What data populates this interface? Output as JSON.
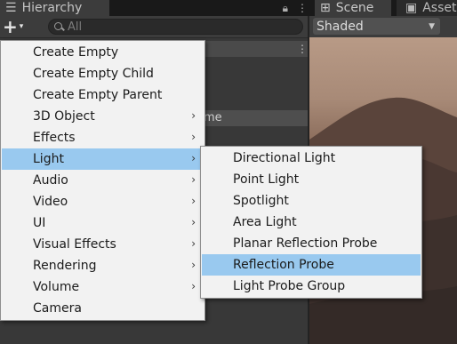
{
  "tabs": {
    "hierarchy": {
      "icon": "list-icon",
      "label": "Hierarchy"
    },
    "scene": {
      "icon": "grid-icon",
      "label": "Scene"
    },
    "assets": {
      "icon": "store-icon",
      "label": "Asset"
    }
  },
  "hierarchy_toolbar": {
    "create_plus": "+",
    "create_caret": "▾",
    "search_placeholder": "All"
  },
  "hierarchy_partial_text": "me",
  "scene": {
    "shading_mode": "Shaded"
  },
  "create_menu": {
    "items": [
      {
        "label": "Create Empty",
        "submenu": false
      },
      {
        "label": "Create Empty Child",
        "submenu": false
      },
      {
        "label": "Create Empty Parent",
        "submenu": false
      },
      {
        "label": "3D Object",
        "submenu": true
      },
      {
        "label": "Effects",
        "submenu": true
      },
      {
        "label": "Light",
        "submenu": true,
        "highlighted": true
      },
      {
        "label": "Audio",
        "submenu": true
      },
      {
        "label": "Video",
        "submenu": true
      },
      {
        "label": "UI",
        "submenu": true
      },
      {
        "label": "Visual Effects",
        "submenu": true
      },
      {
        "label": "Rendering",
        "submenu": true
      },
      {
        "label": "Volume",
        "submenu": true
      },
      {
        "label": "Camera",
        "submenu": false
      }
    ],
    "arrow_glyph": "›"
  },
  "light_submenu": {
    "items": [
      {
        "label": "Directional Light"
      },
      {
        "label": "Point Light"
      },
      {
        "label": "Spotlight"
      },
      {
        "label": "Area Light"
      },
      {
        "label": "Planar Reflection Probe"
      },
      {
        "label": "Reflection Probe",
        "highlighted": true
      },
      {
        "label": "Light Probe Group"
      }
    ]
  },
  "colors": {
    "menu_background": "#f2f2f2",
    "menu_highlight": "#99c9ef",
    "editor_background": "#383838"
  }
}
